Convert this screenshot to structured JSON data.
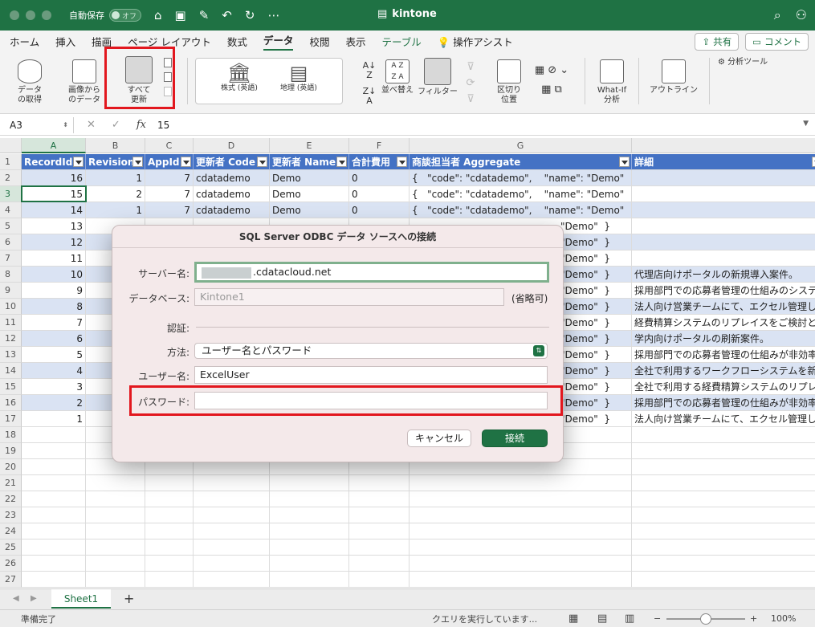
{
  "window": {
    "autosave_label": "自動保存",
    "autosave_state": "オフ",
    "title": "kintone"
  },
  "tabs": [
    "ホーム",
    "挿入",
    "描画",
    "ページ レイアウト",
    "数式",
    "データ",
    "校閲",
    "表示",
    "テーブル",
    "操作アシスト"
  ],
  "active_tab": "データ",
  "tab_actions": {
    "share": "共有",
    "comment": "コメント"
  },
  "ribbon": {
    "get_data": "データ\nの取得",
    "from_picture": "画像から\nのデータ",
    "refresh_all": "すべて\n更新",
    "stocks": "株式 (英語)",
    "geography": "地理 (英語)",
    "sort": "並べ替え",
    "filter": "フィルター",
    "text_to_columns": "区切り\n位置",
    "what_if": "What-If\n分析",
    "outline": "アウトライン",
    "analysis_tools": "分析ツール"
  },
  "formula_bar": {
    "name_box": "A3",
    "fx": "fx",
    "value": "15"
  },
  "columns": [
    "A",
    "B",
    "C",
    "D",
    "E",
    "F",
    "G"
  ],
  "header_row": [
    "RecordId",
    "Revision",
    "AppId",
    "更新者 Code",
    "更新者 Name",
    "合計費用",
    "商談担当者 Aggregate",
    "詳細"
  ],
  "rows": [
    [
      "16",
      "1",
      "7",
      "cdatademo",
      "Demo",
      "0",
      "{   \"code\": \"cdatademo\",    \"name\": \"Demo\"  }",
      ""
    ],
    [
      "15",
      "2",
      "7",
      "cdatademo",
      "Demo",
      "0",
      "{   \"code\": \"cdatademo\",    \"name\": \"Demo\"  }",
      ""
    ],
    [
      "14",
      "1",
      "7",
      "cdatademo",
      "Demo",
      "0",
      "{   \"code\": \"cdatademo\",    \"name\": \"Demo\"  }",
      ""
    ],
    [
      "13",
      "",
      "",
      "",
      "",
      "",
      "\"Demo\"  }",
      ""
    ],
    [
      "12",
      "",
      "",
      "",
      "",
      "",
      "\"Demo\"  }",
      ""
    ],
    [
      "11",
      "",
      "",
      "",
      "",
      "",
      "\"Demo\"  }",
      ""
    ],
    [
      "10",
      "",
      "",
      "",
      "",
      "",
      "\"Demo\"  }",
      "代理店向けポータルの新規導入案件。"
    ],
    [
      "9",
      "",
      "",
      "",
      "",
      "",
      "\"Demo\"  }",
      "採用部門での応募者管理の仕組みのシステ"
    ],
    [
      "8",
      "",
      "",
      "",
      "",
      "",
      "\"Demo\"  }",
      "法人向け営業チームにて、エクセル管理し"
    ],
    [
      "7",
      "",
      "",
      "",
      "",
      "",
      "\"Demo\"  }",
      "経費精算システムのリプレイスをご検討と"
    ],
    [
      "6",
      "",
      "",
      "",
      "",
      "",
      "\"Demo\"  }",
      "学内向けポータルの刷新案件。"
    ],
    [
      "5",
      "",
      "",
      "",
      "",
      "",
      "\"Demo\"  }",
      "採用部門での応募者管理の仕組みが非効率"
    ],
    [
      "4",
      "",
      "",
      "",
      "",
      "",
      "\"Demo\"  }",
      "全社で利用するワークフローシステムを新"
    ],
    [
      "3",
      "",
      "",
      "",
      "",
      "",
      "\"Demo\"  }",
      "全社で利用する経費精算システムのリプレ"
    ],
    [
      "2",
      "",
      "",
      "",
      "",
      "",
      "\"Demo\"  }",
      "採用部門での応募者管理の仕組みが非効率"
    ],
    [
      "1",
      "",
      "",
      "",
      "",
      "",
      "\"Demo\"  }",
      "法人向け営業チームにて、エクセル管理し"
    ]
  ],
  "row_numbers": [
    "1",
    "2",
    "3",
    "4",
    "5",
    "6",
    "7",
    "8",
    "9",
    "10",
    "11",
    "12",
    "13",
    "14",
    "15",
    "16",
    "17",
    "18",
    "19",
    "20",
    "21",
    "22",
    "23",
    "24",
    "25",
    "26",
    "27"
  ],
  "dialog": {
    "title": "SQL Server ODBC データ ソースへの接続",
    "server_label": "サーバー名:",
    "server_value": ".cdatacloud.net",
    "database_label": "データベース:",
    "database_placeholder": "Kintone1",
    "optional_label": "(省略可)",
    "auth_label": "認証:",
    "method_label": "方法:",
    "method_value": "ユーザー名とパスワード",
    "username_label": "ユーザー名:",
    "username_value": "ExcelUser",
    "password_label": "パスワード:",
    "password_value": "",
    "cancel_label": "キャンセル",
    "connect_label": "接続"
  },
  "sheet": {
    "name": "Sheet1",
    "add": "+"
  },
  "status": {
    "left": "準備完了",
    "query": "クエリを実行しています...",
    "zoom": "100%"
  },
  "colors": {
    "accent": "#1f7244",
    "table_header": "#4472c4",
    "band": "#dae3f3",
    "highlight": "#e2171e"
  }
}
